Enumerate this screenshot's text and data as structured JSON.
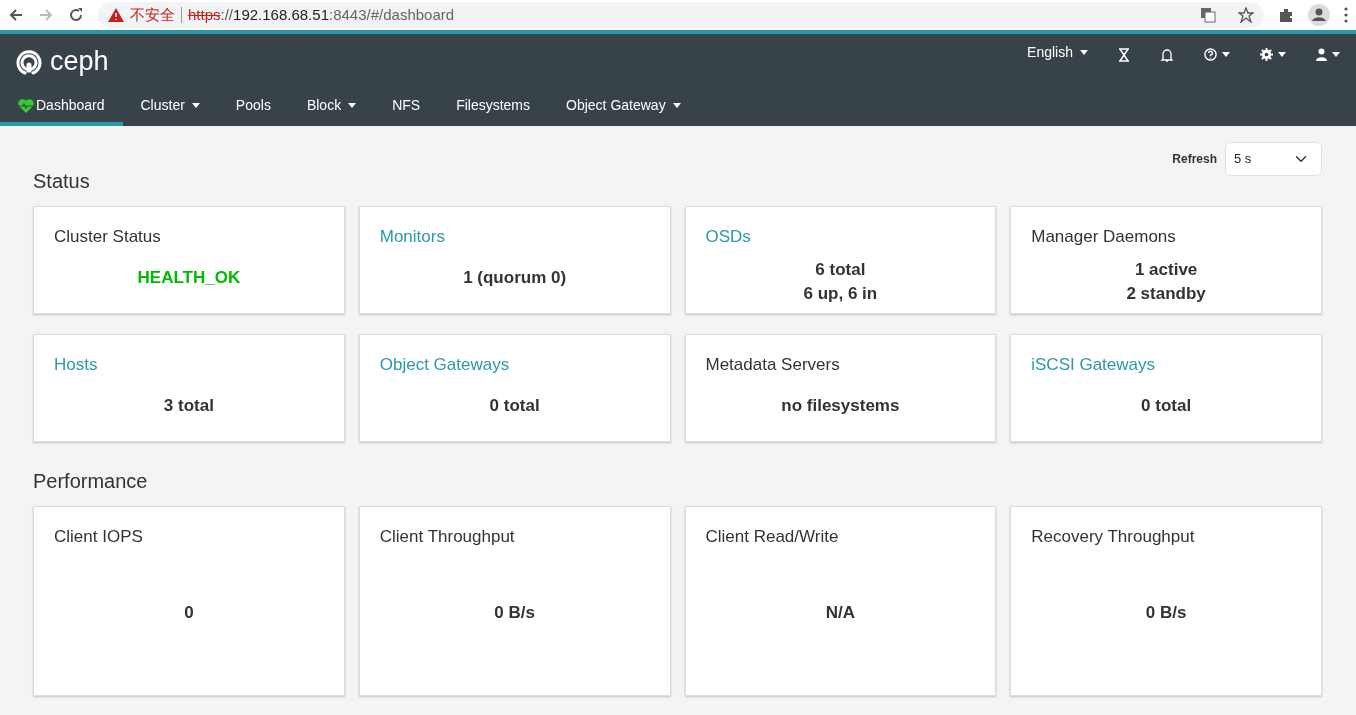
{
  "browser": {
    "security_label": "不安全",
    "scheme": "https",
    "separator": "://",
    "host": "192.168.68.51",
    "rest": ":8443/#/dashboard"
  },
  "navbar": {
    "brand": "ceph",
    "language": "English",
    "tabs": [
      {
        "label": "Dashboard",
        "selected": true,
        "dropdown": false,
        "kind": "home"
      },
      {
        "label": "Cluster",
        "selected": false,
        "dropdown": true
      },
      {
        "label": "Pools",
        "selected": false,
        "dropdown": false
      },
      {
        "label": "Block",
        "selected": false,
        "dropdown": true
      },
      {
        "label": "NFS",
        "selected": false,
        "dropdown": false
      },
      {
        "label": "Filesystems",
        "selected": false,
        "dropdown": false
      },
      {
        "label": "Object Gateway",
        "selected": false,
        "dropdown": true
      }
    ]
  },
  "refresh": {
    "label": "Refresh",
    "value": "5 s"
  },
  "sections": [
    {
      "title": "Status",
      "cards": [
        {
          "title": "Cluster Status",
          "link": false,
          "lines": [
            "HEALTH_OK"
          ],
          "kind": "health"
        },
        {
          "title": "Monitors",
          "link": true,
          "lines": [
            "1 (quorum 0)"
          ]
        },
        {
          "title": "OSDs",
          "link": true,
          "lines": [
            "6 total",
            "6 up, 6 in"
          ]
        },
        {
          "title": "Manager Daemons",
          "link": false,
          "lines": [
            "1 active",
            "2 standby"
          ]
        },
        {
          "title": "Hosts",
          "link": true,
          "lines": [
            "3 total"
          ]
        },
        {
          "title": "Object Gateways",
          "link": true,
          "lines": [
            "0 total"
          ]
        },
        {
          "title": "Metadata Servers",
          "link": false,
          "lines": [
            "no filesystems"
          ]
        },
        {
          "title": "iSCSI Gateways",
          "link": true,
          "lines": [
            "0 total"
          ]
        }
      ]
    },
    {
      "title": "Performance",
      "kind": "chart",
      "cards": [
        {
          "title": "Client IOPS",
          "link": false,
          "lines": [
            "0"
          ]
        },
        {
          "title": "Client Throughput",
          "link": false,
          "lines": [
            "0 B/s"
          ]
        },
        {
          "title": "Client Read/Write",
          "link": false,
          "lines": [
            "N/A"
          ]
        },
        {
          "title": "Recovery Throughput",
          "link": false,
          "lines": [
            "0 B/s"
          ]
        }
      ]
    }
  ]
}
